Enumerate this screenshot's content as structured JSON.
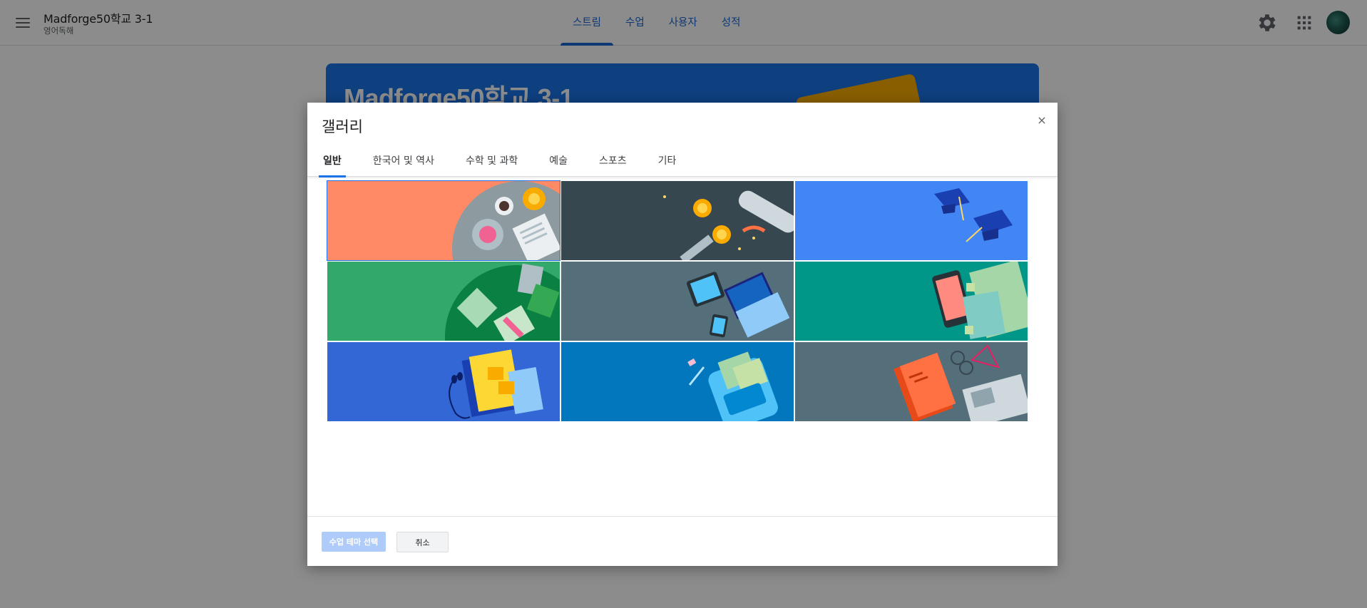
{
  "header": {
    "class_name": "Madforge50학교 3-1",
    "class_section": "영어독해",
    "tabs": [
      {
        "label": "스트림",
        "active": true
      },
      {
        "label": "수업",
        "active": false
      },
      {
        "label": "사용자",
        "active": false
      },
      {
        "label": "성적",
        "active": false
      }
    ],
    "icons": [
      "menu-icon",
      "gear-icon",
      "apps-grid-icon",
      "avatar"
    ]
  },
  "banner": {
    "title": "Madforge50학교 3-1"
  },
  "dialog": {
    "title": "갤러리",
    "close_label": "×",
    "tabs": [
      {
        "label": "일반",
        "active": true
      },
      {
        "label": "한국어 및 역사",
        "active": false
      },
      {
        "label": "수학 및 과학",
        "active": false
      },
      {
        "label": "예술",
        "active": false
      },
      {
        "label": "스포츠",
        "active": false
      },
      {
        "label": "기타",
        "active": false
      }
    ],
    "themes": [
      {
        "name": "theme-breakfast",
        "bg": "#ff8a65",
        "selected": true
      },
      {
        "name": "theme-diploma",
        "bg": "#37474f",
        "selected": false
      },
      {
        "name": "theme-graduation-caps",
        "bg": "#4285f4",
        "selected": false
      },
      {
        "name": "theme-notebooks",
        "bg": "#33a86b",
        "selected": false
      },
      {
        "name": "theme-laptop",
        "bg": "#546e7a",
        "selected": false
      },
      {
        "name": "theme-phone-notes",
        "bg": "#009688",
        "selected": false
      },
      {
        "name": "theme-headphones-book",
        "bg": "#3367d6",
        "selected": false
      },
      {
        "name": "theme-backpack",
        "bg": "#0277bd",
        "selected": false
      },
      {
        "name": "theme-book-glasses",
        "bg": "#546e7a",
        "selected": false
      }
    ],
    "select_button": "수업 테마 선택",
    "cancel_button": "취소"
  },
  "colors": {
    "accent": "#1a73e8",
    "overlay": "rgba(0,0,0,0.45)",
    "select_disabled": "#aecbfa"
  }
}
